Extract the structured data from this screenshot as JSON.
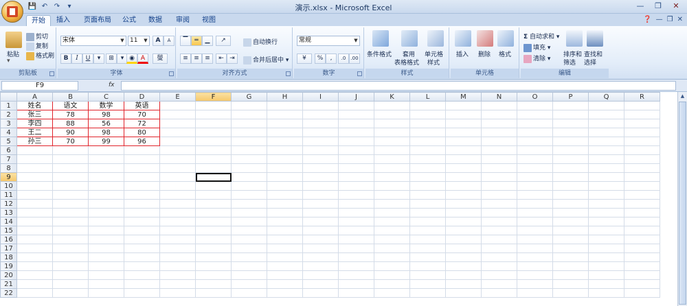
{
  "window": {
    "title": "演示.xlsx - Microsoft Excel"
  },
  "qat": {
    "save": "💾",
    "undo": "↶",
    "redo": "↷",
    "more": "▾"
  },
  "tabs": [
    "开始",
    "插入",
    "页面布局",
    "公式",
    "数据",
    "审阅",
    "视图"
  ],
  "clipboard": {
    "paste": "粘贴",
    "cut": "剪切",
    "copy": "复制",
    "format_painter": "格式刷",
    "label": "剪贴板"
  },
  "font": {
    "name": "宋体",
    "size": "11",
    "grow": "A",
    "shrink": "A",
    "bold": "B",
    "italic": "I",
    "underline": "U",
    "label": "字体",
    "font_color_letter": "A",
    "phonetic": "燮"
  },
  "alignment": {
    "wrap": "自动换行",
    "merge": "合并后居中",
    "label": "对齐方式"
  },
  "number": {
    "format": "常规",
    "percent": "%",
    "comma": ",",
    "label": "数字"
  },
  "styles": {
    "conditional": "条件格式",
    "table_line1": "套用",
    "table_line2": "表格格式",
    "cell_line1": "单元格",
    "cell_line2": "样式",
    "label": "样式"
  },
  "cells": {
    "insert": "插入",
    "delete": "删除",
    "format": "格式",
    "label": "单元格"
  },
  "editing": {
    "autosum": "自动求和",
    "fill": "填充",
    "clear": "清除",
    "sort_line1": "排序和",
    "sort_line2": "筛选",
    "find_line1": "查找和",
    "find_line2": "选择",
    "label": "编辑"
  },
  "formula": {
    "namebox": "F9",
    "fx": "fx",
    "value": ""
  },
  "sheet": {
    "columns": [
      "A",
      "B",
      "C",
      "D",
      "E",
      "F",
      "G",
      "H",
      "I",
      "J",
      "K",
      "L",
      "M",
      "N",
      "O",
      "P",
      "Q",
      "R"
    ],
    "active_column": "F",
    "active_row": 9,
    "rows": [
      [
        "姓名",
        "语文",
        "数学",
        "英语"
      ],
      [
        "张三",
        "78",
        "98",
        "70"
      ],
      [
        "李四",
        "88",
        "56",
        "72"
      ],
      [
        "王二",
        "90",
        "98",
        "80"
      ],
      [
        "孙三",
        "70",
        "99",
        "96"
      ]
    ],
    "row_count": 22
  },
  "colors": {
    "accent": "#15428b",
    "data_border": "#e0232b",
    "selection": "#f5c76a"
  }
}
